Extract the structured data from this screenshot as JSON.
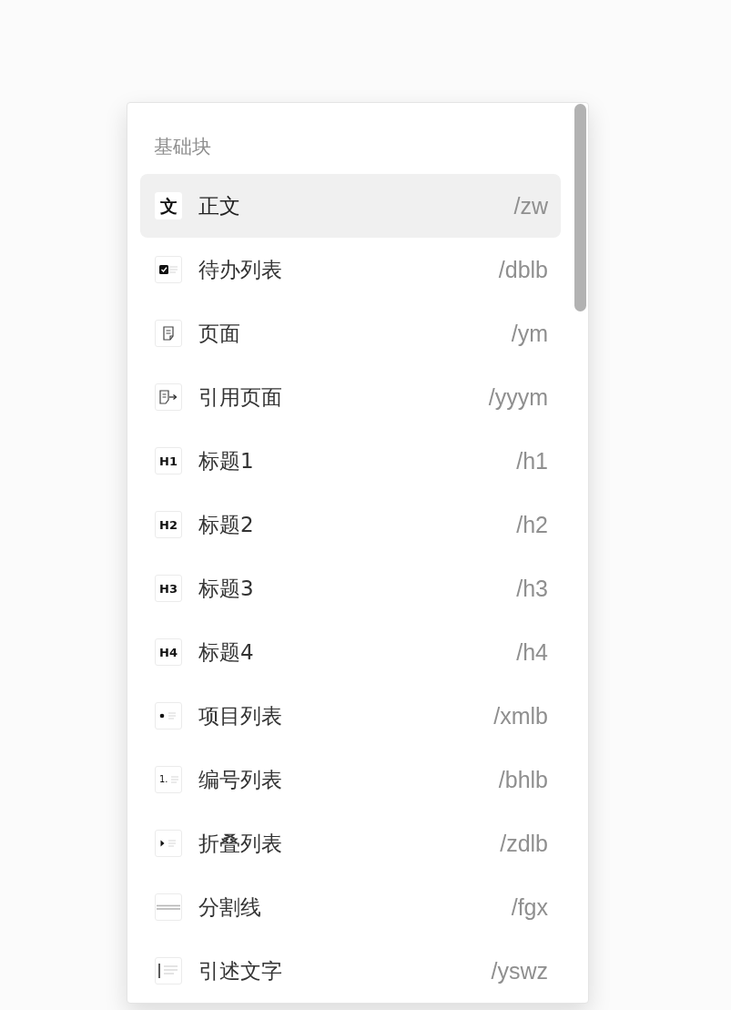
{
  "menu": {
    "section_title": "基础块",
    "items": [
      {
        "kind": "glyph",
        "icon_text": "文",
        "label": "正文",
        "shortcut": "/zw",
        "selected": true
      },
      {
        "kind": "todo",
        "label": "待办列表",
        "shortcut": "/dblb",
        "selected": false
      },
      {
        "kind": "page",
        "label": "页面",
        "shortcut": "/ym",
        "selected": false
      },
      {
        "kind": "page-ref",
        "label": "引用页面",
        "shortcut": "/yyym",
        "selected": false
      },
      {
        "kind": "heading",
        "icon_text": "H1",
        "label": "标题1",
        "shortcut": "/h1",
        "selected": false
      },
      {
        "kind": "heading",
        "icon_text": "H2",
        "label": "标题2",
        "shortcut": "/h2",
        "selected": false
      },
      {
        "kind": "heading",
        "icon_text": "H3",
        "label": "标题3",
        "shortcut": "/h3",
        "selected": false
      },
      {
        "kind": "heading",
        "icon_text": "H4",
        "label": "标题4",
        "shortcut": "/h4",
        "selected": false
      },
      {
        "kind": "bullet",
        "label": "项目列表",
        "shortcut": "/xmlb",
        "selected": false
      },
      {
        "kind": "numbered",
        "icon_text": "1.",
        "label": "编号列表",
        "shortcut": "/bhlb",
        "selected": false
      },
      {
        "kind": "toggle",
        "label": "折叠列表",
        "shortcut": "/zdlb",
        "selected": false
      },
      {
        "kind": "divider",
        "label": "分割线",
        "shortcut": "/fgx",
        "selected": false
      },
      {
        "kind": "quote",
        "label": "引述文字",
        "shortcut": "/yswz",
        "selected": false
      }
    ]
  }
}
